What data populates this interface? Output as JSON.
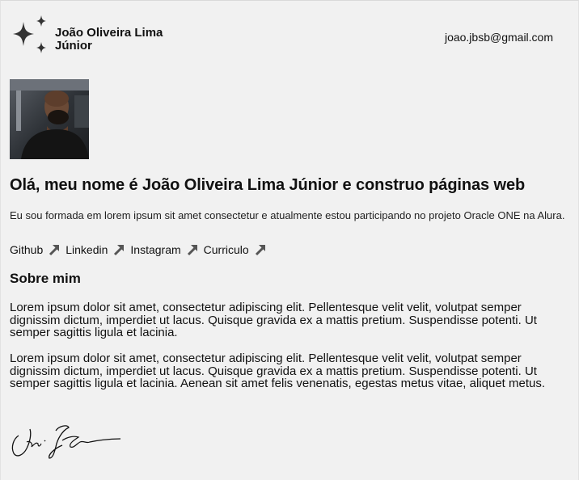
{
  "header": {
    "logo_icon": "sparkles-icon",
    "name": "João Oliveira Lima Júnior",
    "email": "joao.jbsb@gmail.com"
  },
  "profile": {
    "photo": "profile-photo"
  },
  "hero": {
    "headline": "Olá, meu nome é João Oliveira Lima Júnior e construo páginas web",
    "intro": "Eu sou formada em lorem ipsum sit amet consectetur e atualmente estou participando no projeto Oracle ONE na Alura."
  },
  "links": [
    {
      "label": "Github",
      "icon": "arrow-up-right-icon"
    },
    {
      "label": "Linkedin",
      "icon": "arrow-up-right-icon"
    },
    {
      "label": "Instagram",
      "icon": "arrow-up-right-icon"
    },
    {
      "label": "Curriculo",
      "icon": "arrow-up-right-icon"
    }
  ],
  "about": {
    "title": "Sobre mim",
    "paragraphs": [
      "Lorem ipsum dolor sit amet, consectetur adipiscing elit. Pellentesque velit velit, volutpat semper dignissim dictum, imperdiet ut lacus. Quisque gravida ex a mattis pretium. Suspendisse potenti. Ut semper sagittis ligula et lacinia.",
      "Lorem ipsum dolor sit amet, consectetur adipiscing elit. Pellentesque velit velit, volutpat semper dignissim dictum, imperdiet ut lacus. Quisque gravida ex a mattis pretium. Suspendisse potenti. Ut semper sagittis ligula et lacinia. Aenean sit amet felis venenatis, egestas metus vitae, aliquet metus."
    ]
  },
  "signature": {
    "icon": "handwritten-signature"
  },
  "colors": {
    "background": "#f1f1f1",
    "text": "#111111",
    "icon": "#333333"
  }
}
